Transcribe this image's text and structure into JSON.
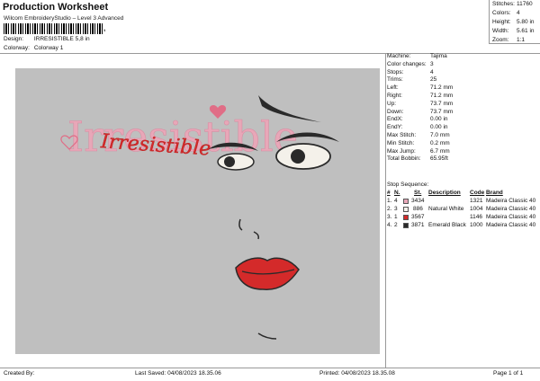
{
  "header": {
    "title": "Production Worksheet",
    "subtitle": "Wilcom EmbroideryStudio – Level 3 Advanced",
    "barcode_mark": ",",
    "design_label": "Design:",
    "design_value": "IRRESISTIBLE 5,8 in",
    "colorway_label": "Colorway:",
    "colorway_value": "Colorway 1"
  },
  "stats": [
    {
      "label": "Stitches:",
      "value": "11760"
    },
    {
      "label": "Colors:",
      "value": "4"
    },
    {
      "label": "Height:",
      "value": "5.80 in"
    },
    {
      "label": "Width:",
      "value": "5.61 in"
    },
    {
      "label": "Zoom:",
      "value": "1:1"
    }
  ],
  "machine_info": [
    {
      "label": "Machine:",
      "value": "Tajima"
    },
    {
      "label": "Color changes:",
      "value": "3"
    },
    {
      "label": "Stops:",
      "value": "4"
    },
    {
      "label": "Trims:",
      "value": "25"
    },
    {
      "label": "Left:",
      "value": "71.2 mm"
    },
    {
      "label": "Right:",
      "value": "71.2 mm"
    },
    {
      "label": "Up:",
      "value": "73.7 mm"
    },
    {
      "label": "Down:",
      "value": "73.7 mm"
    },
    {
      "label": "EndX:",
      "value": "0.00 in"
    },
    {
      "label": "EndY:",
      "value": "0.00 in"
    },
    {
      "label": "Max Stitch:",
      "value": "7.0 mm"
    },
    {
      "label": "Min Stitch:",
      "value": "0.2 mm"
    },
    {
      "label": "Max Jump:",
      "value": "6.7 mm"
    },
    {
      "label": "Total Bobbin:",
      "value": "65.95ft"
    }
  ],
  "stop_sequence": {
    "title": "Stop Sequence:",
    "headers": {
      "num": "#",
      "n": "N.",
      "st": "St.",
      "desc": "Description",
      "code": "Code",
      "brand": "Brand"
    },
    "rows": [
      {
        "num": "1.",
        "n": "4",
        "swatch": "#e8a7b8",
        "st": "3434",
        "desc": "",
        "code": "1321",
        "brand": "Madeira Classic 40"
      },
      {
        "num": "2.",
        "n": "3",
        "swatch": "#f4f1ea",
        "st": "886",
        "desc": "Natural White",
        "code": "1004",
        "brand": "Madeira Classic 40"
      },
      {
        "num": "3.",
        "n": "1",
        "swatch": "#d42a2a",
        "st": "3567",
        "desc": "",
        "code": "1146",
        "brand": "Madeira Classic 40"
      },
      {
        "num": "4.",
        "n": "2",
        "swatch": "#2a2a2a",
        "st": "3871",
        "desc": "Emerald Black",
        "code": "1000",
        "brand": "Madeira Classic 40"
      }
    ]
  },
  "design_text": {
    "script_word": "Irresistible",
    "back_word": "Irresistible"
  },
  "colors": {
    "canvas": "#bfbfbf",
    "pink": "#e8a7b8",
    "red": "#d42a2a",
    "black": "#2a2a2a",
    "white": "#f4f1ea"
  },
  "footer": {
    "created": "Created By:",
    "saved": "Last Saved: 04/08/2023 18.35.06",
    "printed": "Printed: 04/08/2023 18.35.08",
    "page": "Page 1 of 1"
  }
}
